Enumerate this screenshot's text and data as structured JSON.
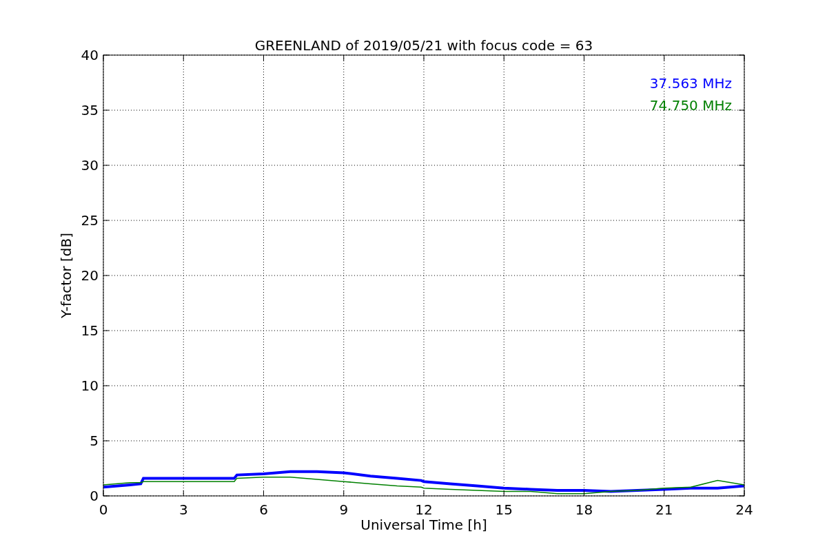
{
  "figure": {
    "chart_data": {
      "type": "line",
      "title": "GREENLAND of 2019/05/21 with focus code = 63",
      "xlabel": "Universal Time [h]",
      "ylabel": "Y-factor [dB]",
      "x": [
        0,
        1,
        1.4,
        1.5,
        3,
        4.9,
        5,
        6,
        7,
        8,
        9,
        10,
        11,
        11.9,
        12,
        13,
        14,
        15,
        16,
        17,
        18,
        19,
        20,
        21,
        22,
        23,
        24
      ],
      "series": [
        {
          "name": "37.563 MHz",
          "color": "#0000ff",
          "values": [
            0.8,
            1.0,
            1.1,
            1.6,
            1.6,
            1.6,
            1.9,
            2.0,
            2.2,
            2.2,
            2.1,
            1.8,
            1.6,
            1.4,
            1.3,
            1.1,
            0.9,
            0.7,
            0.6,
            0.5,
            0.5,
            0.4,
            0.5,
            0.6,
            0.7,
            0.7,
            0.9
          ]
        },
        {
          "name": "74.750 MHz",
          "color": "#008000",
          "values": [
            1.0,
            1.2,
            1.2,
            1.3,
            1.3,
            1.3,
            1.6,
            1.7,
            1.7,
            1.5,
            1.3,
            1.1,
            0.9,
            0.8,
            0.7,
            0.6,
            0.5,
            0.4,
            0.4,
            0.2,
            0.2,
            0.4,
            0.5,
            0.7,
            0.8,
            1.4,
            1.0
          ]
        }
      ],
      "grid": true,
      "xlim": [
        0,
        24
      ],
      "ylim": [
        0,
        40
      ],
      "xticks": [
        0,
        3,
        6,
        9,
        12,
        15,
        18,
        21,
        24
      ],
      "yticks": [
        0,
        5,
        10,
        15,
        20,
        25,
        30,
        35,
        40
      ]
    }
  }
}
